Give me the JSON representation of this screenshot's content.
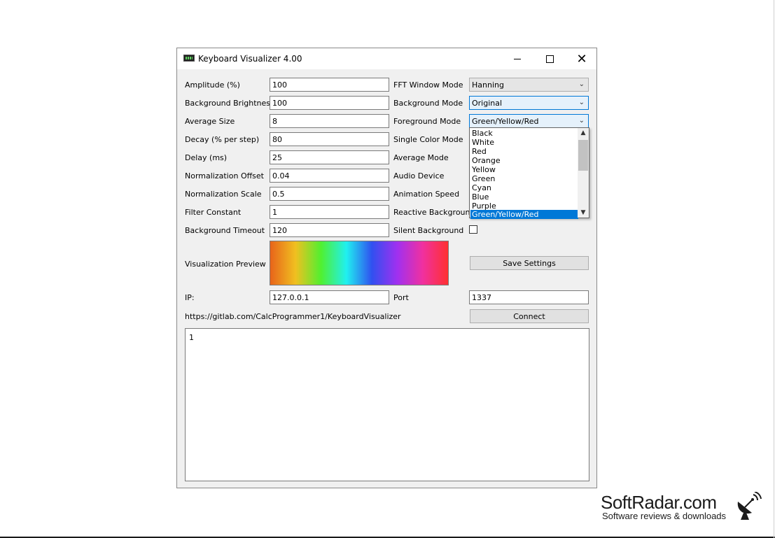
{
  "window": {
    "title": "Keyboard Visualizer 4.00",
    "close_glyph": "✕"
  },
  "left_fields": [
    {
      "label": "Amplitude (%)",
      "value": "100"
    },
    {
      "label": "Background Brightness",
      "value": "100"
    },
    {
      "label": "Average Size",
      "value": "8"
    },
    {
      "label": "Decay (% per step)",
      "value": "80"
    },
    {
      "label": "Delay (ms)",
      "value": "25"
    },
    {
      "label": "Normalization Offset",
      "value": "0.04"
    },
    {
      "label": "Normalization Scale",
      "value": "0.5"
    },
    {
      "label": "Filter Constant",
      "value": "1"
    },
    {
      "label": "Background Timeout",
      "value": "120"
    }
  ],
  "right_labels": {
    "fft_window_mode": "FFT Window Mode",
    "background_mode": "Background Mode",
    "foreground_mode": "Foreground Mode",
    "single_color_mode": "Single Color Mode",
    "average_mode": "Average Mode",
    "audio_device": "Audio Device",
    "animation_speed": "Animation Speed",
    "reactive_background": "Reactive Background",
    "silent_background": "Silent Background"
  },
  "combos": {
    "fft_window_mode": "Hanning",
    "background_mode": "Original",
    "foreground_mode": "Green/Yellow/Red"
  },
  "silent_background_checked": false,
  "preview": {
    "label": "Visualization Preview",
    "gradient_colors": [
      "#e8641a",
      "#f0c020",
      "#50f030",
      "#20f0f0",
      "#3050f0",
      "#a030f0",
      "#f030a0",
      "#ff3030"
    ]
  },
  "save_settings_label": "Save Settings",
  "network": {
    "ip_label": "IP:",
    "ip_value": "127.0.0.1",
    "port_label": "Port",
    "port_value": "1337",
    "connect_label": "Connect"
  },
  "link_text": "https://gitlab.com/CalcProgrammer1/KeyboardVisualizer",
  "output_text": "1",
  "dropdown": {
    "items": [
      "Black",
      "White",
      "Red",
      "Orange",
      "Yellow",
      "Green",
      "Cyan",
      "Blue",
      "Purple",
      "Green/Yellow/Red"
    ],
    "selected": "Green/Yellow/Red"
  },
  "watermark": {
    "brand": "SoftRadar.com",
    "tagline": "Software reviews & downloads"
  }
}
